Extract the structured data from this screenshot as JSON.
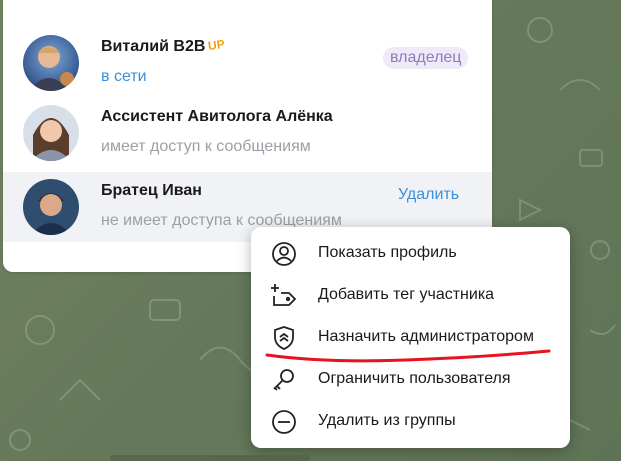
{
  "members": [
    {
      "name": "Виталий B2B",
      "status": "в сети",
      "role_badge": "владелец",
      "badge_text": "UP"
    },
    {
      "name": "Ассистент Авитолога Алёнка",
      "status": "имеет доступ к сообщениям"
    },
    {
      "name": "Братец Иван",
      "status": "не имеет доступа к сообщениям",
      "action": "Удалить"
    }
  ],
  "context_menu": {
    "items": [
      {
        "label": "Показать профиль",
        "icon": "user-circle-icon"
      },
      {
        "label": "Добавить тег участника",
        "icon": "tag-add-icon"
      },
      {
        "label": "Назначить администратором",
        "icon": "shield-icon"
      },
      {
        "label": "Ограничить пользователя",
        "icon": "key-icon"
      },
      {
        "label": "Удалить из группы",
        "icon": "minus-circle-icon"
      }
    ]
  },
  "colors": {
    "accent": "#3a8fd9",
    "owner_badge_bg": "#efe9f8",
    "owner_badge_text": "#8f7ac1",
    "annotation_underline": "#e8131f"
  }
}
